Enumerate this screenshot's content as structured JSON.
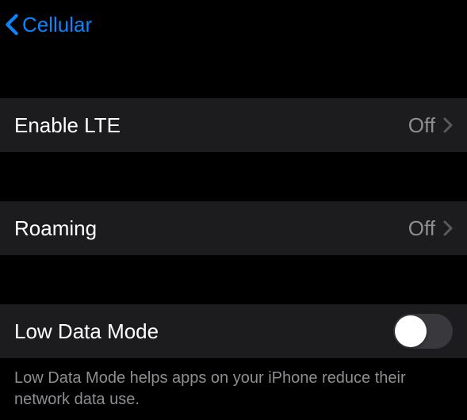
{
  "nav": {
    "back_label": "Cellular"
  },
  "rows": {
    "enable_lte": {
      "label": "Enable LTE",
      "value": "Off"
    },
    "roaming": {
      "label": "Roaming",
      "value": "Off"
    },
    "low_data_mode": {
      "label": "Low Data Mode"
    }
  },
  "footer": {
    "low_data_text": "Low Data Mode helps apps on your iPhone reduce their network data use."
  }
}
